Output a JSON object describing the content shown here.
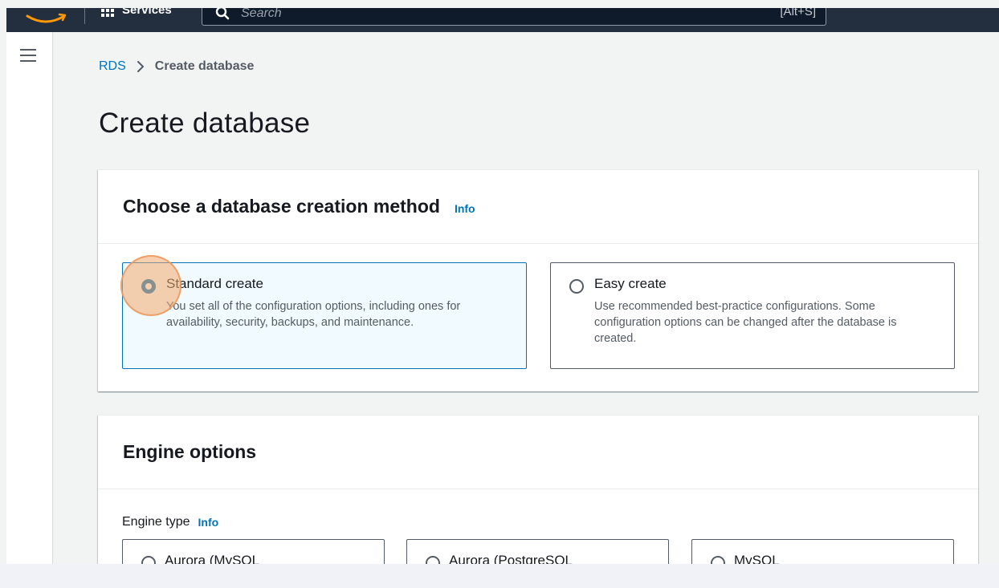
{
  "topnav": {
    "services_label": "Services",
    "search_placeholder": "Search",
    "search_shortcut": "[Alt+S]"
  },
  "breadcrumb": {
    "root": "RDS",
    "current": "Create database"
  },
  "page": {
    "title": "Create database"
  },
  "creation_method": {
    "title": "Choose a database creation method",
    "info": "Info",
    "options": [
      {
        "label": "Standard create",
        "description": "You set all of the configuration options, including ones for availability, security, backups, and maintenance.",
        "selected": true
      },
      {
        "label": "Easy create",
        "description": "Use recommended best-practice configurations. Some configuration options can be changed after the database is created.",
        "selected": false
      }
    ]
  },
  "engine_options": {
    "title": "Engine options",
    "engine_type_label": "Engine type",
    "info": "Info",
    "engines": [
      {
        "label": "Aurora (MySQL"
      },
      {
        "label": "Aurora (PostgreSQL"
      },
      {
        "label": "MySQL"
      }
    ]
  },
  "colors": {
    "accent": "#0073bb",
    "nav": "#232f3e",
    "click_indicator": "#f3aa6e"
  }
}
